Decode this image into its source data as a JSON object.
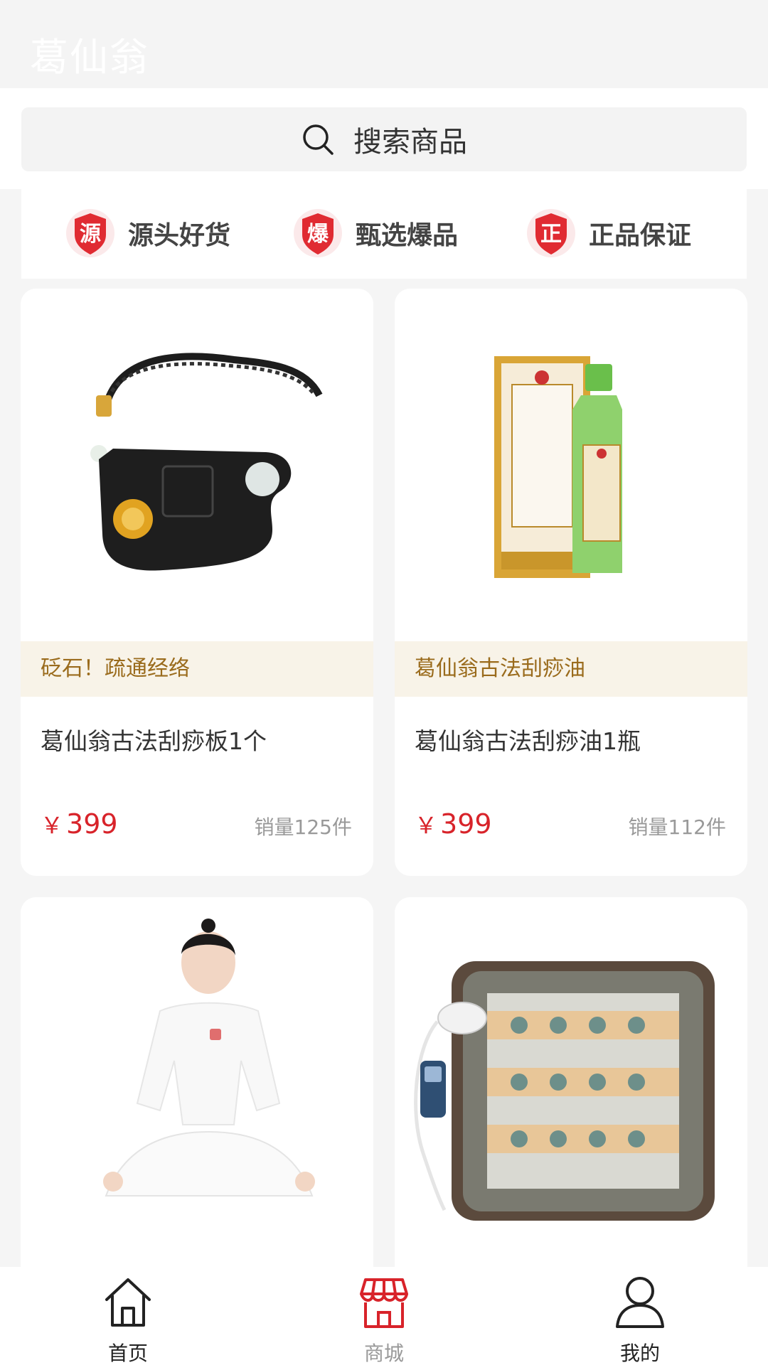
{
  "header": {
    "title": "葛仙翁"
  },
  "search": {
    "placeholder": "搜索商品",
    "icon": "search-icon"
  },
  "features": [
    {
      "icon_char": "源",
      "label": "源头好货"
    },
    {
      "icon_char": "爆",
      "label": "甄选爆品"
    },
    {
      "icon_char": "正",
      "label": "正品保证"
    }
  ],
  "products": [
    {
      "tag": "砭石！疏通经络",
      "title": "葛仙翁古法刮痧板1个",
      "currency": "￥",
      "price": "399",
      "sales": "销量125件",
      "image": "gua-sha-board-image"
    },
    {
      "tag": "葛仙翁古法刮痧油",
      "title": "葛仙翁古法刮痧油1瓶",
      "currency": "￥",
      "price": "399",
      "sales": "销量112件",
      "image": "gua-sha-oil-image"
    },
    {
      "tag": "",
      "title": "",
      "currency": "",
      "price": "",
      "sales": "",
      "image": "meditation-person-image"
    },
    {
      "tag": "",
      "title": "",
      "currency": "",
      "price": "",
      "sales": "",
      "image": "heating-stone-mat-image"
    }
  ],
  "tabbar": {
    "items": [
      {
        "label": "首页",
        "icon": "home-icon",
        "active": false
      },
      {
        "label": "商城",
        "icon": "shop-icon",
        "active": true
      },
      {
        "label": "我的",
        "icon": "user-icon",
        "active": false
      }
    ]
  },
  "colors": {
    "accent": "#d8232a",
    "tag_bg": "#f8f3e8",
    "tag_text": "#9a6b1c",
    "tab_active": "#d8232a"
  }
}
